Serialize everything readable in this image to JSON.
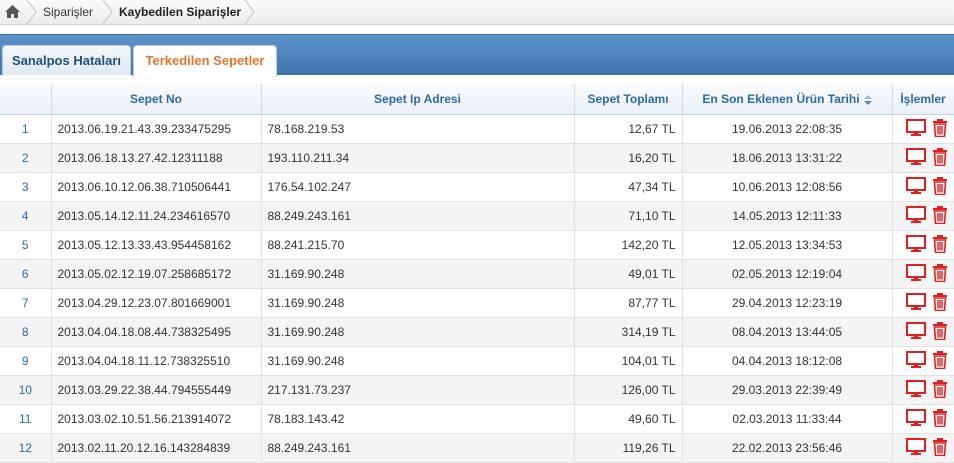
{
  "breadcrumb": {
    "home_icon": "home-icon",
    "items": [
      "Siparişler",
      "Kaybedilen Siparişler"
    ]
  },
  "tabs": [
    {
      "label": "Sanalpos Hataları",
      "active": false
    },
    {
      "label": "Terkedilen Sepetler",
      "active": true
    }
  ],
  "table": {
    "columns": [
      "",
      "Sepet No",
      "Sepet Ip Adresi",
      "Sepet Toplamı",
      "En Son Eklenen Ürün Tarihi",
      "İşlemler"
    ],
    "sorted_column": "En Son Eklenen Ürün Tarihi",
    "row_icons": [
      "monitor-icon",
      "trash-icon"
    ],
    "rows": [
      {
        "n": "1",
        "sepet": "2013.06.19.21.43.39.233475295",
        "ip": "78.168.219.53",
        "toplam": "12,67 TL",
        "tarih": "19.06.2013 22:08:35"
      },
      {
        "n": "2",
        "sepet": "2013.06.18.13.27.42.12311188",
        "ip": "193.110.211.34",
        "toplam": "16,20 TL",
        "tarih": "18.06.2013 13:31:22"
      },
      {
        "n": "3",
        "sepet": "2013.06.10.12.06.38.710506441",
        "ip": "176.54.102.247",
        "toplam": "47,34 TL",
        "tarih": "10.06.2013 12:08:56"
      },
      {
        "n": "4",
        "sepet": "2013.05.14.12.11.24.234616570",
        "ip": "88.249.243.161",
        "toplam": "71,10 TL",
        "tarih": "14.05.2013 12:11:33"
      },
      {
        "n": "5",
        "sepet": "2013.05.12.13.33.43.954458162",
        "ip": "88.241.215.70",
        "toplam": "142,20 TL",
        "tarih": "12.05.2013 13:34:53"
      },
      {
        "n": "6",
        "sepet": "2013.05.02.12.19.07.258685172",
        "ip": "31.169.90.248",
        "toplam": "49,01 TL",
        "tarih": "02.05.2013 12:19:04"
      },
      {
        "n": "7",
        "sepet": "2013.04.29.12.23.07.801669001",
        "ip": "31.169.90.248",
        "toplam": "87,77 TL",
        "tarih": "29.04.2013 12:23:19"
      },
      {
        "n": "8",
        "sepet": "2013.04.04.18.08.44.738325495",
        "ip": "31.169.90.248",
        "toplam": "314,19 TL",
        "tarih": "08.04.2013 13:44:05"
      },
      {
        "n": "9",
        "sepet": "2013.04.04.18.11.12.738325510",
        "ip": "31.169.90.248",
        "toplam": "104,01 TL",
        "tarih": "04.04.2013 18:12:08"
      },
      {
        "n": "10",
        "sepet": "2013.03.29.22.38.44.794555449",
        "ip": "217.131.73.237",
        "toplam": "126,00 TL",
        "tarih": "29.03.2013 22:39:49"
      },
      {
        "n": "11",
        "sepet": "2013.03.02.10.51.56.213914072",
        "ip": "78.183.143.42",
        "toplam": "49,60 TL",
        "tarih": "02.03.2013 11:33:44"
      },
      {
        "n": "12",
        "sepet": "2013.02.11.20.12.16.143284839",
        "ip": "88.249.243.161",
        "toplam": "119,26 TL",
        "tarih": "22.02.2013 23:56:46"
      }
    ]
  },
  "colors": {
    "tab_band": "#4a80bc",
    "active_tab_text": "#e4762b",
    "header_text": "#2e6aa6",
    "icon_red": "#e02020"
  }
}
